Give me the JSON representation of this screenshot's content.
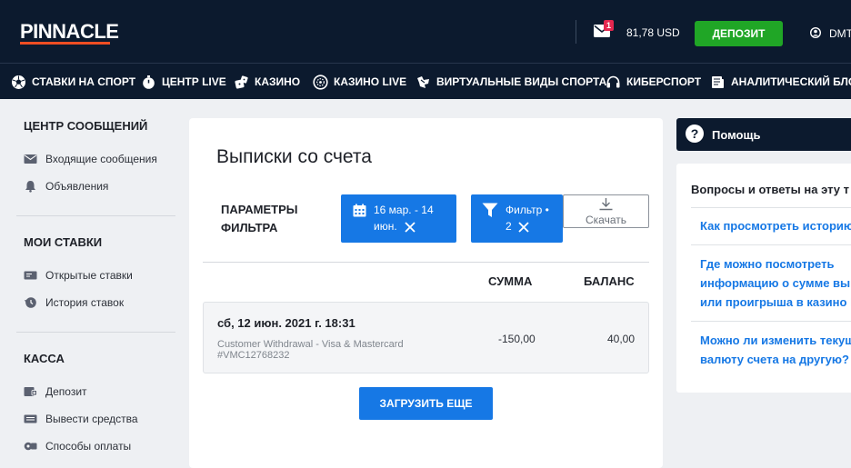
{
  "header": {
    "logo": "PINNACLE",
    "mail_badge": "1",
    "balance": "81,78 USD",
    "deposit_label": "ДЕПОЗИТ",
    "user_name": "DMT"
  },
  "nav": [
    {
      "label": "СТАВКИ НА СПОРТ",
      "icon": "soccer-ball-icon"
    },
    {
      "label": "ЦЕНТР LIVE",
      "icon": "stopwatch-icon"
    },
    {
      "label": "КАЗИНО",
      "icon": "dice-icon"
    },
    {
      "label": "КАЗИНО LIVE",
      "icon": "roulette-icon"
    },
    {
      "label": "ВИРТУАЛЬНЫЕ ВИДЫ СПОРТА",
      "icon": "virtual-sports-icon"
    },
    {
      "label": "КИБЕРСПОРТ",
      "icon": "headset-icon"
    },
    {
      "label": "АНАЛИТИЧЕСКИЙ БЛОГ",
      "icon": "blog-icon"
    }
  ],
  "sidebar": {
    "sections": [
      {
        "heading": "ЦЕНТР СООБЩЕНИЙ",
        "items": [
          "Входящие сообщения",
          "Объявления"
        ]
      },
      {
        "heading": "МОИ СТАВКИ",
        "items": [
          "Открытые ставки",
          "История ставок"
        ]
      },
      {
        "heading": "КАССА",
        "items": [
          "Депозит",
          "Вывести средства",
          "Способы оплаты"
        ]
      }
    ]
  },
  "main": {
    "title": "Выписки со счета",
    "filter_label_1": "ПАРАМЕТРЫ",
    "filter_label_2": "ФИЛЬТРА",
    "date_chip_line1": "16 мар. - 14",
    "date_chip_line2": "июн.",
    "filter_chip_line1": "Фильтр •",
    "filter_chip_line2": "2",
    "download_label": "Скачать",
    "col_sum": "СУММА",
    "col_balance": "БАЛАНС",
    "transaction": {
      "date": "сб, 12 июн. 2021 г. 18:31",
      "description": "Customer Withdrawal - Visa & Mastercard",
      "reference": "#VMC12768232",
      "amount": "-150,00",
      "balance": "40,00"
    },
    "load_more_label": "ЗАГРУЗИТЬ ЕЩЕ"
  },
  "help": {
    "title": "Помощь",
    "faq_title": "Вопросы и ответы на эту т",
    "questions": [
      [
        "Как просмотреть историю"
      ],
      [
        "Где можно посмотреть",
        "информацию о сумме выи",
        "или проигрыша в казино P"
      ],
      [
        "Можно ли изменить текущ",
        "валюту счета на другую?"
      ]
    ]
  },
  "colors": {
    "header_bg": "#0c1a2e",
    "accent_blue": "#1678e5",
    "deposit_green": "#20a626",
    "logo_underline": "#f04e23",
    "badge_red": "#e5274f"
  }
}
